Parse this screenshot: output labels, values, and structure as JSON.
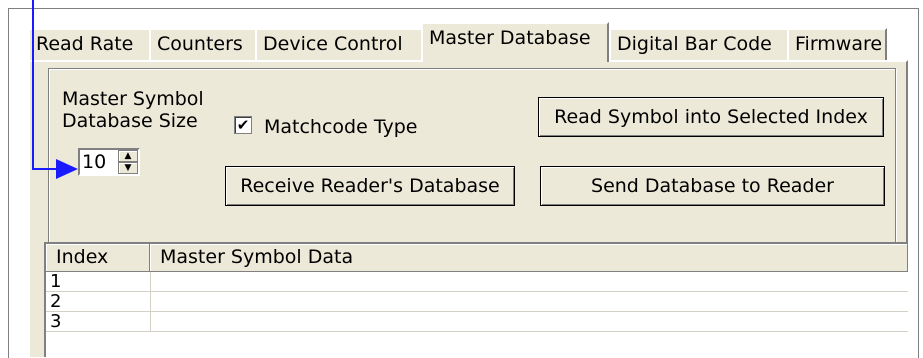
{
  "tabs": [
    {
      "label": "Read Rate"
    },
    {
      "label": "Counters"
    },
    {
      "label": "Device Control"
    },
    {
      "label": "Master Database",
      "active": true
    },
    {
      "label": "Digital Bar Code"
    },
    {
      "label": "Firmware"
    }
  ],
  "group": {
    "size_label_line1": "Master Symbol",
    "size_label_line2": "Database Size",
    "size_value": "10",
    "matchcode_label": "Matchcode Type",
    "matchcode_checked": true
  },
  "buttons": {
    "read_symbol": "Read Symbol into Selected Index",
    "receive_db": "Receive Reader's Database",
    "send_db": "Send Database to Reader"
  },
  "table": {
    "columns": [
      "Index",
      "Master Symbol Data"
    ],
    "rows": [
      {
        "index": "1",
        "data": ""
      },
      {
        "index": "2",
        "data": ""
      },
      {
        "index": "3",
        "data": ""
      }
    ]
  },
  "icons": {
    "pointer_arrow": "right-arrow-icon",
    "spin_up": "spin-up-icon",
    "spin_down": "spin-down-icon",
    "checkmark": "checkmark-icon"
  },
  "colors": {
    "pointer": "#1a1aff",
    "panel": "#ece9d8"
  }
}
